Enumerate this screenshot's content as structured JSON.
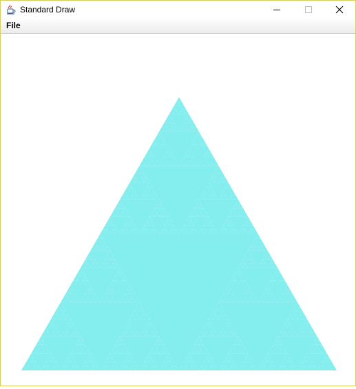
{
  "window": {
    "title": "Standard Draw",
    "icon": "java-cup-icon"
  },
  "title_buttons": {
    "minimize_icon": "minimize-icon",
    "maximize_icon": "maximize-icon",
    "close_icon": "close-icon"
  },
  "menubar": {
    "items": [
      "File"
    ]
  },
  "drawing": {
    "shape": "sierpinski-triangle",
    "depth": 6,
    "fill_color": "#84eded",
    "background_color": "#ffffff"
  },
  "colors": {
    "window_border": "#d7cf5a",
    "title_text": "#000000"
  }
}
